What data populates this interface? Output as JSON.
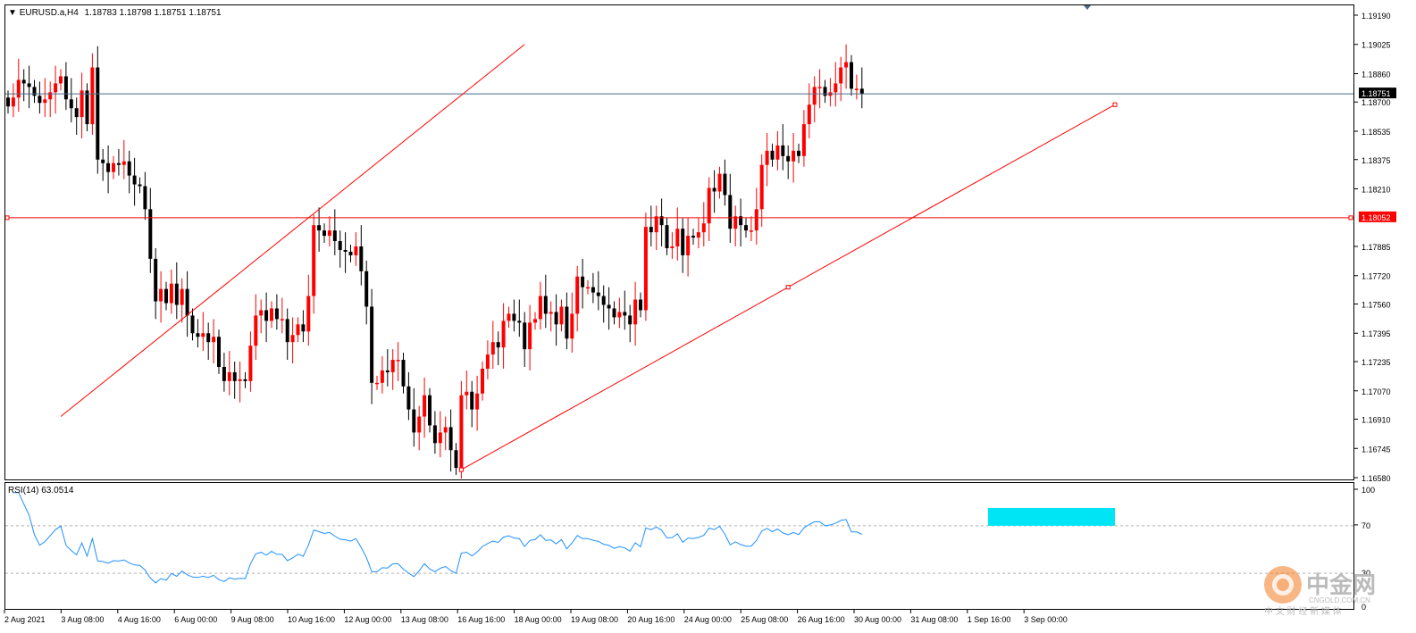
{
  "header": {
    "symbol": "EURUSD.a,H4",
    "ohlc": "1.18783 1.18798 1.18751 1.18751"
  },
  "rsi_header": "RSI(14) 63.0514",
  "price_labels": {
    "current": "1.18751",
    "level": "1.18052"
  },
  "watermark": {
    "brand": "中金网",
    "domain": "CNGOLD.COM.CN",
    "slogan": "中 文 财 经 新 媒 体"
  },
  "colors": {
    "bull": "#ff0000",
    "bear": "#000000",
    "trend": "#ff0000",
    "current_line": "#4a6a8a",
    "rsi_line": "#1e90ff",
    "highlight": "#00e5f5"
  },
  "chart_data": [
    {
      "type": "candlestick",
      "symbol": "EURUSD.a",
      "timeframe": "H4",
      "ylim": [
        1.1658,
        1.1919
      ],
      "y_ticks": [
        "1.19190",
        "1.19025",
        "1.18860",
        "1.18700",
        "1.18535",
        "1.18375",
        "1.18210",
        "1.18052",
        "1.17885",
        "1.17720",
        "1.17560",
        "1.17395",
        "1.17235",
        "1.17070",
        "1.16910",
        "1.16745",
        "1.16580"
      ],
      "x_tick_labels": [
        "2 Aug 2021",
        "3 Aug 08:00",
        "4 Aug 16:00",
        "6 Aug 00:00",
        "9 Aug 08:00",
        "10 Aug 16:00",
        "12 Aug 00:00",
        "13 Aug 08:00",
        "16 Aug 16:00",
        "18 Aug 00:00",
        "19 Aug 08:00",
        "20 Aug 16:00",
        "24 Aug 00:00",
        "25 Aug 08:00",
        "26 Aug 16:00",
        "30 Aug 00:00",
        "31 Aug 08:00",
        "1 Sep 16:00",
        "3 Sep 00:00"
      ],
      "close": [
        1.1868,
        1.1873,
        1.1883,
        1.1881,
        1.1879,
        1.1874,
        1.187,
        1.1872,
        1.1876,
        1.1881,
        1.1885,
        1.1872,
        1.1867,
        1.1862,
        1.1877,
        1.1858,
        1.189,
        1.1838,
        1.1836,
        1.1831,
        1.1836,
        1.1835,
        1.1837,
        1.1829,
        1.1824,
        1.1823,
        1.181,
        1.1782,
        1.1758,
        1.1765,
        1.1757,
        1.1768,
        1.1756,
        1.1765,
        1.175,
        1.174,
        1.1738,
        1.174,
        1.1735,
        1.1738,
        1.1721,
        1.1713,
        1.1718,
        1.1713,
        1.1714,
        1.1713,
        1.1733,
        1.175,
        1.1753,
        1.1747,
        1.1754,
        1.1748,
        1.1748,
        1.1735,
        1.1739,
        1.1745,
        1.1741,
        1.1761,
        1.1801,
        1.1798,
        1.1795,
        1.1798,
        1.1792,
        1.1787,
        1.1786,
        1.1784,
        1.1789,
        1.1775,
        1.1755,
        1.1712,
        1.1712,
        1.1719,
        1.1718,
        1.1725,
        1.1725,
        1.171,
        1.1697,
        1.1684,
        1.1693,
        1.1705,
        1.1688,
        1.1678,
        1.1684,
        1.1687,
        1.1674,
        1.1664,
        1.1705,
        1.1707,
        1.1697,
        1.1706,
        1.172,
        1.1728,
        1.1735,
        1.1732,
        1.1747,
        1.1751,
        1.1747,
        1.1746,
        1.1731,
        1.1746,
        1.1748,
        1.1761,
        1.1751,
        1.1752,
        1.1745,
        1.1755,
        1.1737,
        1.1751,
        1.1772,
        1.1766,
        1.1766,
        1.1763,
        1.1761,
        1.1756,
        1.1754,
        1.1749,
        1.1752,
        1.175,
        1.1745,
        1.1759,
        1.1753,
        1.18,
        1.1797,
        1.1806,
        1.1801,
        1.1788,
        1.1789,
        1.1799,
        1.1784,
        1.1795,
        1.1794,
        1.1797,
        1.1802,
        1.1822,
        1.182,
        1.183,
        1.1818,
        1.1799,
        1.1806,
        1.1801,
        1.1798,
        1.1798,
        1.181,
        1.1835,
        1.1843,
        1.1838,
        1.1846,
        1.184,
        1.1837,
        1.1843,
        1.184,
        1.1858,
        1.1869,
        1.1879,
        1.1879,
        1.1874,
        1.1876,
        1.1881,
        1.189,
        1.1893,
        1.1878,
        1.1878,
        1.1875
      ]
    },
    {
      "type": "line",
      "name": "RSI(14)",
      "ylim": [
        0,
        100
      ],
      "y_ticks": [
        "100",
        "70",
        "30",
        "0"
      ],
      "levels": [
        70,
        30
      ],
      "last_value": 63.0514,
      "highlight_zone": [
        70,
        85
      ]
    }
  ]
}
